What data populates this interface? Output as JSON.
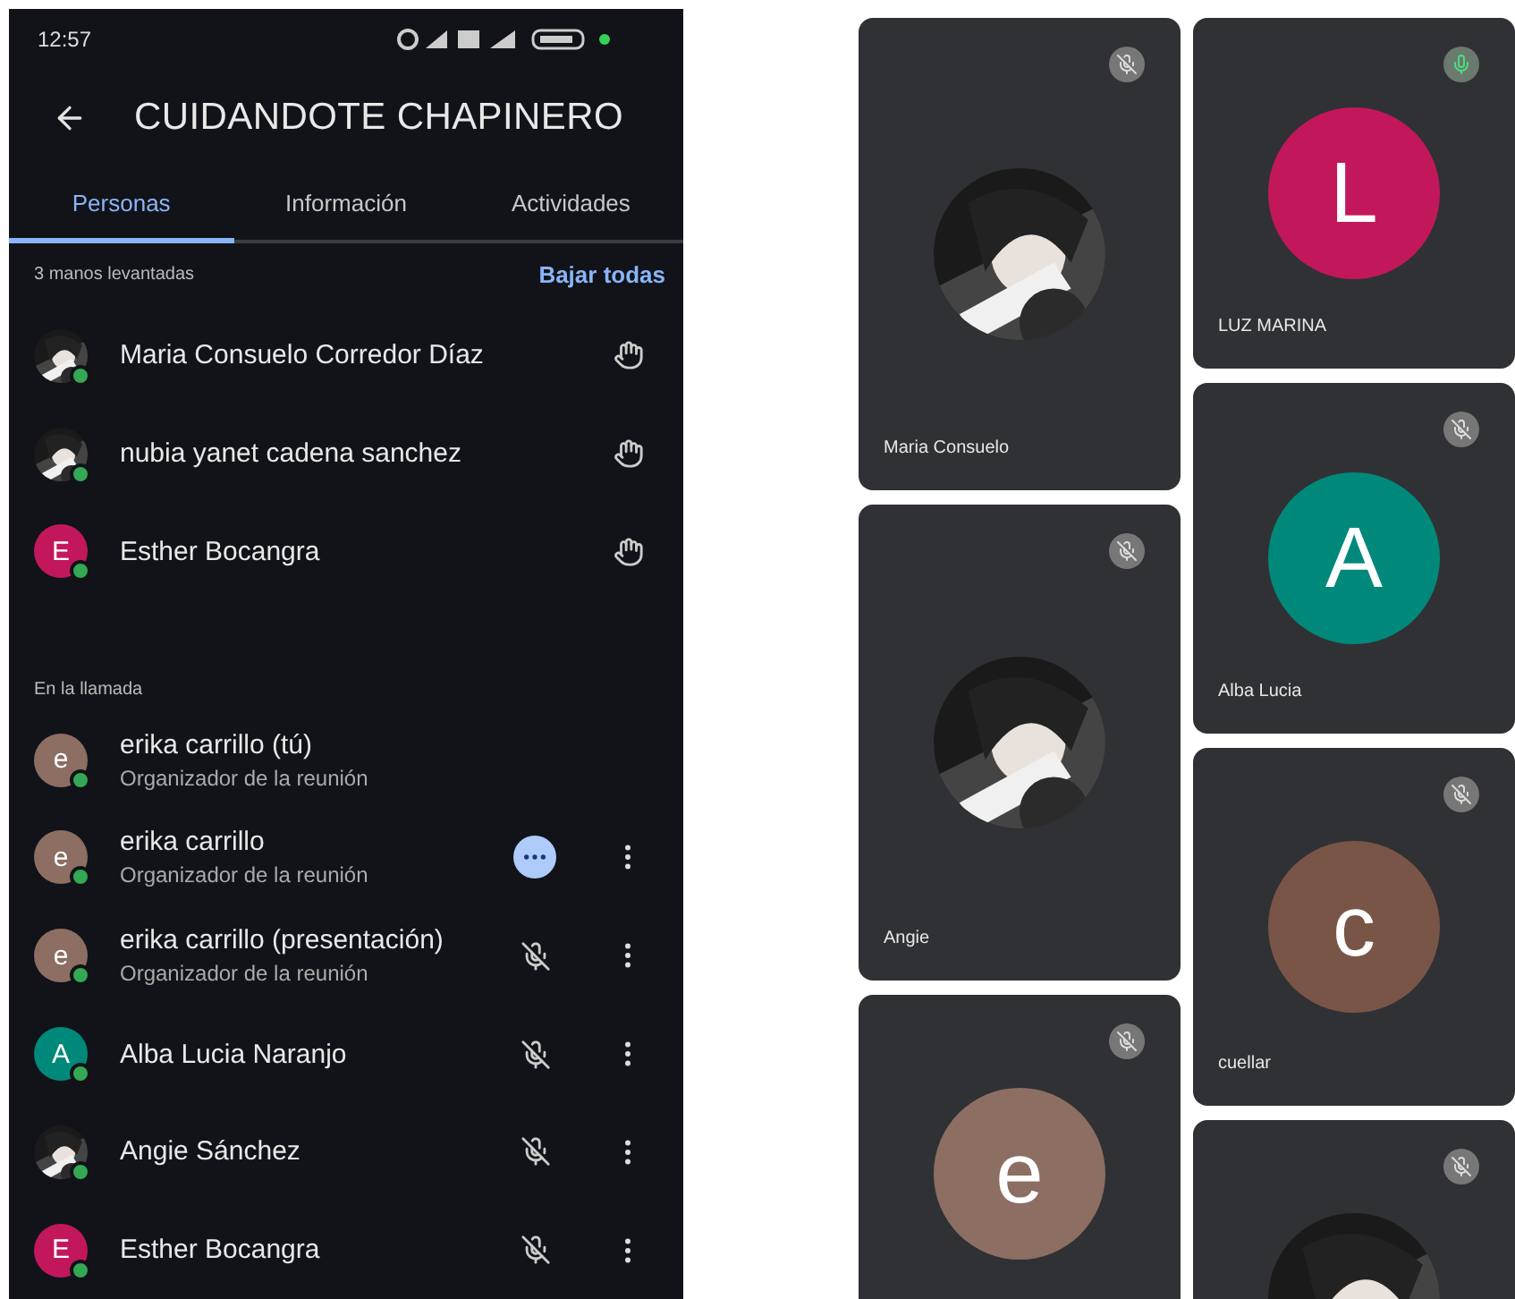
{
  "status_bar": {
    "time": "12:57"
  },
  "header": {
    "title": "CUIDANDOTE CHAPINERO"
  },
  "tabs": [
    {
      "label": "Personas",
      "selected": true
    },
    {
      "label": "Información",
      "selected": false
    },
    {
      "label": "Actividades",
      "selected": false
    }
  ],
  "raised_hands": {
    "label": "3 manos levantadas",
    "action": "Bajar todas",
    "people": [
      {
        "name": "Maria Consuelo Corredor Díaz"
      },
      {
        "name": "nubia yanet cadena sanchez"
      },
      {
        "name": "Esther Bocangra",
        "avatar": {
          "kind": "letter",
          "letter": "E",
          "color": "#c2185b"
        }
      }
    ]
  },
  "in_call": {
    "label": "En la llamada",
    "people": [
      {
        "name": "erika carrillo (tú)",
        "subtitle": "Organizador de la reunión",
        "avatar": {
          "kind": "letter",
          "letter": "e",
          "color": "#8d6e63"
        },
        "speaking": false,
        "muted": false,
        "menu": false
      },
      {
        "name": "erika carrillo",
        "subtitle": "Organizador de la reunión",
        "avatar": {
          "kind": "letter",
          "letter": "e",
          "color": "#8d6e63"
        },
        "speaking": true,
        "muted": false,
        "menu": true
      },
      {
        "name": "erika carrillo (presentación)",
        "subtitle": "Organizador de la reunión",
        "avatar": {
          "kind": "letter",
          "letter": "e",
          "color": "#8d6e63"
        },
        "speaking": false,
        "muted": true,
        "menu": true
      },
      {
        "name": "Alba Lucia Naranjo",
        "avatar": {
          "kind": "letter",
          "letter": "A",
          "color": "#00897b"
        },
        "speaking": false,
        "muted": true,
        "menu": true
      },
      {
        "name": "Angie Sánchez",
        "speaking": false,
        "muted": true,
        "menu": true
      },
      {
        "name": "Esther Bocangra",
        "avatar": {
          "kind": "letter",
          "letter": "E",
          "color": "#c2185b"
        },
        "speaking": false,
        "muted": true,
        "menu": true
      }
    ]
  },
  "grid": {
    "columns": [
      [
        {
          "name": "Maria Consuelo",
          "muted": true
        },
        {
          "name": "Angie",
          "muted": true
        },
        {
          "avatar": {
            "kind": "letter",
            "letter": "e",
            "color": "#8d6e63"
          },
          "muted": true
        }
      ],
      [
        {
          "name": "LUZ MARINA",
          "avatar": {
            "kind": "letter",
            "letter": "L",
            "color": "#c2185b"
          },
          "muted": false
        },
        {
          "name": "Alba Lucia",
          "avatar": {
            "kind": "letter",
            "letter": "A",
            "color": "#00897b"
          },
          "muted": true
        },
        {
          "name": "cuellar",
          "avatar": {
            "kind": "letter",
            "letter": "c",
            "color": "#795548"
          },
          "muted": true
        },
        {
          "muted": true
        }
      ]
    ]
  }
}
